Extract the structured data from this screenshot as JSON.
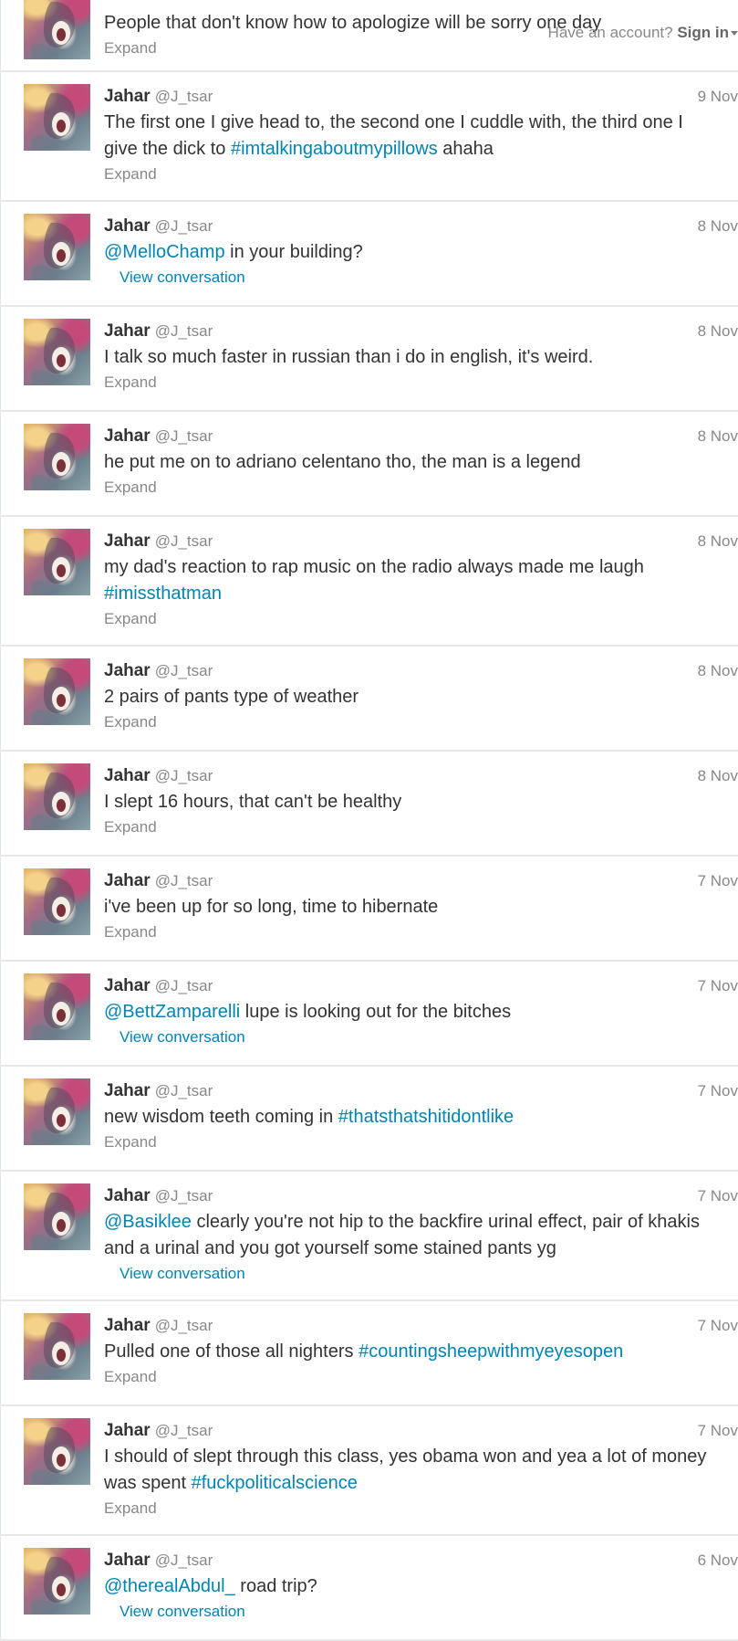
{
  "topbar": {
    "prompt": "Have an account?",
    "signin": "Sign in"
  },
  "first_tweet": {
    "text": "People that don't know how to apologize will be sorry one day",
    "action": "Expand"
  },
  "tweets": [
    {
      "name": "Jahar",
      "handle": "@J_tsar",
      "date": "9 Nov",
      "action": "Expand",
      "view": "expand",
      "parts": [
        {
          "t": "The first one I give head to, the second one I cuddle with, the third one I give the dick to "
        },
        {
          "t": "#imtalkingaboutmypillows",
          "link": true
        },
        {
          "t": " ahaha"
        }
      ]
    },
    {
      "name": "Jahar",
      "handle": "@J_tsar",
      "date": "8 Nov",
      "action": "View conversation",
      "view": "conv",
      "parts": [
        {
          "t": "@MelloChamp",
          "link": true
        },
        {
          "t": " in your building?"
        }
      ]
    },
    {
      "name": "Jahar",
      "handle": "@J_tsar",
      "date": "8 Nov",
      "action": "Expand",
      "view": "expand",
      "parts": [
        {
          "t": "I talk so much faster in russian than i do in english, it's weird."
        }
      ]
    },
    {
      "name": "Jahar",
      "handle": "@J_tsar",
      "date": "8 Nov",
      "action": "Expand",
      "view": "expand",
      "parts": [
        {
          "t": "he put me on to adriano celentano tho, the man is a legend"
        }
      ]
    },
    {
      "name": "Jahar",
      "handle": "@J_tsar",
      "date": "8 Nov",
      "action": "Expand",
      "view": "expand",
      "parts": [
        {
          "t": "my dad's reaction to rap music on the radio always made me laugh "
        },
        {
          "t": "#imissthatman",
          "link": true
        }
      ]
    },
    {
      "name": "Jahar",
      "handle": "@J_tsar",
      "date": "8 Nov",
      "action": "Expand",
      "view": "expand",
      "parts": [
        {
          "t": "2 pairs of pants type of weather"
        }
      ]
    },
    {
      "name": "Jahar",
      "handle": "@J_tsar",
      "date": "8 Nov",
      "action": "Expand",
      "view": "expand",
      "parts": [
        {
          "t": "I slept 16 hours, that can't be healthy"
        }
      ]
    },
    {
      "name": "Jahar",
      "handle": "@J_tsar",
      "date": "7 Nov",
      "action": "Expand",
      "view": "expand",
      "parts": [
        {
          "t": "i've been up for so long, time to hibernate"
        }
      ]
    },
    {
      "name": "Jahar",
      "handle": "@J_tsar",
      "date": "7 Nov",
      "action": "View conversation",
      "view": "conv",
      "parts": [
        {
          "t": "@BettZamparelli",
          "link": true
        },
        {
          "t": "  lupe is looking out for the bitches"
        }
      ]
    },
    {
      "name": "Jahar",
      "handle": "@J_tsar",
      "date": "7 Nov",
      "action": "Expand",
      "view": "expand",
      "parts": [
        {
          "t": "new wisdom teeth coming in "
        },
        {
          "t": "#thatsthatshitidontlike",
          "link": true
        }
      ]
    },
    {
      "name": "Jahar",
      "handle": "@J_tsar",
      "date": "7 Nov",
      "action": "View conversation",
      "view": "conv",
      "parts": [
        {
          "t": "@Basiklee",
          "link": true
        },
        {
          "t": " clearly you're not hip to the backfire urinal effect, pair of khakis and a urinal and you got yourself some stained pants yg"
        }
      ]
    },
    {
      "name": "Jahar",
      "handle": "@J_tsar",
      "date": "7 Nov",
      "action": "Expand",
      "view": "expand",
      "parts": [
        {
          "t": "Pulled one of those all nighters "
        },
        {
          "t": "#countingsheepwithmyeyesopen",
          "link": true
        }
      ]
    },
    {
      "name": "Jahar",
      "handle": "@J_tsar",
      "date": "7 Nov",
      "action": "Expand",
      "view": "expand",
      "parts": [
        {
          "t": "I should of slept through this class, yes obama won and yea a lot of money was  spent "
        },
        {
          "t": "#fuckpoliticalscience",
          "link": true
        }
      ]
    },
    {
      "name": "Jahar",
      "handle": "@J_tsar",
      "date": "6 Nov",
      "action": "View conversation",
      "view": "conv",
      "parts": [
        {
          "t": "@therealAbdul_",
          "link": true
        },
        {
          "t": " road trip?"
        }
      ]
    }
  ]
}
